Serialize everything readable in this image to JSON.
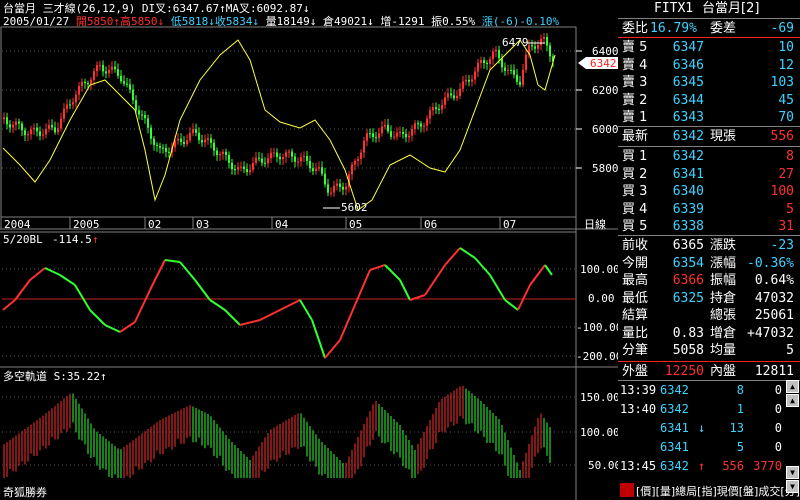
{
  "header": {
    "line1": "台當月  三才線(26,12,9) DI叉:6347.67↑MA叉:6092.87↓",
    "date": "2005/01/27",
    "open": "開5850↑",
    "high": "高5850↓",
    "low": "低5818↓",
    "close": "收5834↓",
    "volume": "量18149↓",
    "oi": "倉49021↓",
    "oi_change": "增-1291",
    "amplitude": "振0.55%",
    "change": "漲(-6)-0.10%"
  },
  "price_axis": [
    "6400",
    "6200",
    "6000",
    "5800"
  ],
  "current_price_tag": "6342",
  "peak_label": "6479",
  "trough_label": "5602",
  "month_axis": [
    "2004",
    "2005",
    "02",
    "03",
    "04",
    "05",
    "06",
    "07"
  ],
  "month_axis_right": "日線",
  "panel2": {
    "title": "5/20BL",
    "value": "-114.5",
    "arrow": "↑",
    "axis": [
      "100.00",
      "0.00",
      "-100.00",
      "-200.00"
    ]
  },
  "panel3": {
    "title": "多空軌道 S:35.22↑",
    "axis": [
      "150.00",
      "100.00",
      "50.00"
    ]
  },
  "watermark": "奇狐勝券",
  "quote": {
    "symbol": "FITX1",
    "name": "台當月[2]",
    "ratio_label": "委比",
    "ratio_value": "16.79%",
    "diff_label": "委差",
    "diff_value": "-69",
    "asks": [
      {
        "label": "賣 5",
        "price": "6347",
        "qty": "10"
      },
      {
        "label": "賣 4",
        "price": "6346",
        "qty": "12"
      },
      {
        "label": "賣 3",
        "price": "6345",
        "qty": "103"
      },
      {
        "label": "賣 2",
        "price": "6344",
        "qty": "45"
      },
      {
        "label": "賣 1",
        "price": "6343",
        "qty": "70"
      }
    ],
    "last_label": "最新",
    "last_value": "6342",
    "curvol_label": "現張",
    "curvol_value": "556",
    "bids": [
      {
        "label": "買 1",
        "price": "6342",
        "qty": "8"
      },
      {
        "label": "買 2",
        "price": "6341",
        "qty": "27"
      },
      {
        "label": "買 3",
        "price": "6340",
        "qty": "100"
      },
      {
        "label": "買 4",
        "price": "6339",
        "qty": "5"
      },
      {
        "label": "買 5",
        "price": "6338",
        "qty": "31"
      }
    ],
    "stats": [
      {
        "l1": "前收",
        "v1": "6365",
        "c1": "white",
        "l2": "漲跌",
        "v2": "-23",
        "c2": "cyan"
      },
      {
        "l1": "今開",
        "v1": "6354",
        "c1": "cyan",
        "l2": "漲幅",
        "v2": "-0.36%",
        "c2": "cyan"
      },
      {
        "l1": "最高",
        "v1": "6366",
        "c1": "red",
        "l2": "振幅",
        "v2": "0.64%",
        "c2": "white"
      },
      {
        "l1": "最低",
        "v1": "6325",
        "c1": "cyan",
        "l2": "持倉",
        "v2": "47032",
        "c2": "white"
      },
      {
        "l1": "結算",
        "v1": "",
        "c1": "white",
        "l2": "總張",
        "v2": "25061",
        "c2": "white"
      },
      {
        "l1": "量比",
        "v1": "0.83",
        "c1": "white",
        "l2": "增倉",
        "v2": "+47032",
        "c2": "white"
      },
      {
        "l1": "分筆",
        "v1": "5058",
        "c1": "white",
        "l2": "均量",
        "v2": "5",
        "c2": "white"
      }
    ],
    "outer_label": "外盤",
    "outer_value": "12250",
    "inner_label": "內盤",
    "inner_value": "12811",
    "ticks": [
      {
        "time": "13:39",
        "price": "6342",
        "arrow": "",
        "vol": "8",
        "oi": "0"
      },
      {
        "time": "13:40",
        "price": "6342",
        "arrow": "",
        "vol": "1",
        "oi": "0"
      },
      {
        "time": "",
        "price": "6341",
        "arrow": "↓",
        "vol": "13",
        "oi": "0"
      },
      {
        "time": "",
        "price": "6341",
        "arrow": "",
        "vol": "5",
        "oi": "0"
      },
      {
        "time": "13:45",
        "price": "6342",
        "arrow": "↑",
        "vol": "556",
        "oi": "3770"
      }
    ],
    "status_text": "[價][量]總局[指]現價[盤]成交[分]"
  },
  "colors": {
    "up": "#ff3030",
    "down": "#30ff30",
    "line_yellow": "#ffff40",
    "quote_cyan": "#3fd3ff",
    "grid": "#444444"
  }
}
